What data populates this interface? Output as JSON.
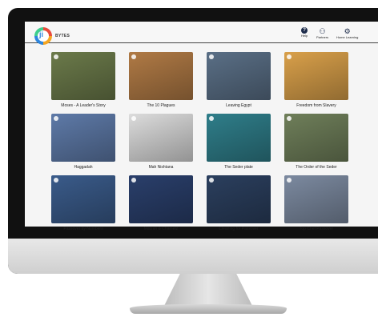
{
  "app": {
    "brand": "BYTES",
    "logo_letter": "ji"
  },
  "header": {
    "nav": [
      {
        "label": "Help",
        "icon": "help-icon",
        "glyph": "?"
      },
      {
        "label": "Partners",
        "icon": "partners-icon",
        "glyph": "⚇"
      },
      {
        "label": "Home Learning",
        "icon": "home-learning-icon",
        "glyph": "⚙"
      }
    ]
  },
  "lessons": [
    {
      "title": "Moses - A Leader's Story",
      "bg": "#6b7a4a"
    },
    {
      "title": "The 10 Plagues",
      "bg": "#b07a45"
    },
    {
      "title": "Leaving Egypt",
      "bg": "#5a6f86"
    },
    {
      "title": "Freedom from Slavery",
      "bg": "#d9a04a"
    },
    {
      "title": "Haggadah",
      "bg": "#5e7aa8"
    },
    {
      "title": "Mah Nishtana",
      "bg": "#dcdcdc"
    },
    {
      "title": "The Seder plate",
      "bg": "#2f7e8a"
    },
    {
      "title": "The Order of the Seder",
      "bg": "#6f7f5a"
    },
    {
      "title": "Passover by Numbers",
      "bg": "#3a5b8a"
    },
    {
      "title": "Matzah & Chametz",
      "bg": "#2a3f6b"
    },
    {
      "title": "Cleaning for Passover",
      "bg": "#2b3f5e"
    },
    {
      "title": "Top Chef Passover",
      "bg": "#7c8aa0"
    }
  ]
}
